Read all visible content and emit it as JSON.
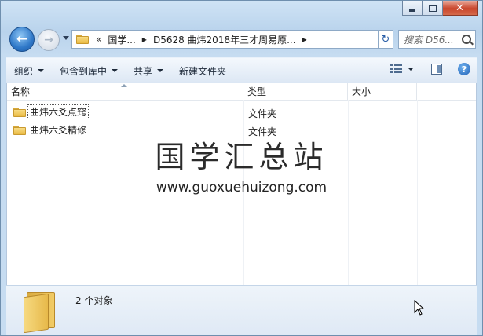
{
  "window": {
    "controls": {
      "minimize_icon": "minimize-icon",
      "maximize_icon": "maximize-icon",
      "close_label": "✕"
    }
  },
  "nav": {
    "back_glyph": "←",
    "forward_glyph": "→",
    "breadcrumb": {
      "overflow": "«",
      "items": [
        "国学...",
        "D5628 曲炜2018年三才周易原..."
      ]
    },
    "refresh_glyph": "↻",
    "search_placeholder": "搜索 D56..."
  },
  "toolbar": {
    "organize": "组织",
    "include_in_library": "包含到库中",
    "share": "共享",
    "new_folder": "新建文件夹"
  },
  "columns": {
    "name": "名称",
    "type": "类型",
    "size": "大小"
  },
  "files": [
    {
      "name": "曲炜六爻点窍",
      "type": "文件夹",
      "size": ""
    },
    {
      "name": "曲炜六爻精修",
      "type": "文件夹",
      "size": ""
    }
  ],
  "watermark": {
    "title": "国学汇总站",
    "url": "www.guoxuehuizong.com"
  },
  "details": {
    "count_text": "2 个对象"
  },
  "colors": {
    "title_bar": "#c6dcf1",
    "close_button": "#c9462c",
    "folder": "#e9bb45"
  }
}
